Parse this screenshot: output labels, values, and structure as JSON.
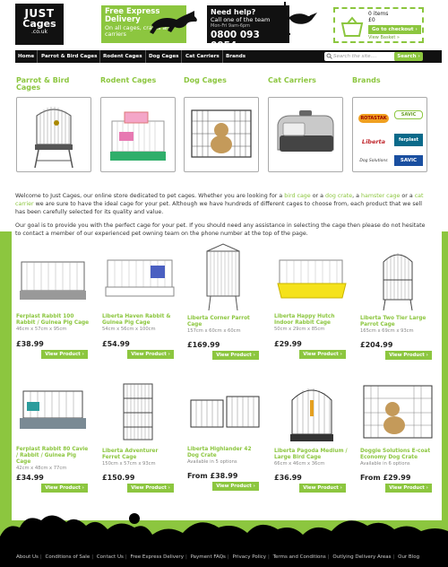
{
  "header": {
    "logo": {
      "line1": "JUST",
      "line2": "Cages",
      "line3": ".co.uk"
    },
    "delivery": {
      "title": "Free Express Delivery",
      "subtitle": "On all cages, crates and carriers"
    },
    "help": {
      "title": "Need help?",
      "subtitle": "Call one of the team",
      "hours": "Mon-Fri 9am-6pm",
      "phone": "0800 093 0054"
    },
    "basket": {
      "items": "0 items",
      "total": "£0",
      "checkout": "Go to checkout ›",
      "view": "View Basket »"
    }
  },
  "nav": {
    "items": [
      "Home",
      "Parrot & Bird Cages",
      "Rodent Cages",
      "Dog Cages",
      "Cat Carriers",
      "Brands"
    ],
    "search_placeholder": "Search the site....",
    "search_button": "Search ›"
  },
  "categories": [
    {
      "label": "Parrot & Bird Cages"
    },
    {
      "label": "Rodent Cages"
    },
    {
      "label": "Dog Cages"
    },
    {
      "label": "Cat Carriers"
    },
    {
      "label": "Brands"
    }
  ],
  "brands": [
    "ROTASTAK",
    "SAVIC",
    "Liberta",
    "ferplast",
    "Dog Solutions",
    "SAVIC"
  ],
  "intro": {
    "p1_a": "Welcome to Just Cages, our online store dedicated to pet cages. Whether you are looking for a ",
    "link1": "bird cage",
    "p1_b": " or a ",
    "link2": "dog crate",
    "p1_c": ", a ",
    "link3": "hamster cage",
    "p1_d": " or a ",
    "link4": "cat carrier",
    "p1_e": " we are sure to have the ideal cage for your pet. Although we have hundreds of different cages to choose from, each product that we sell has been carefully selected for its quality and value.",
    "p2": "Our goal is to provide you with the perfect cage for your pet. If you should need any assistance in selecting the cage then please do not hesitate to contact a member of our experienced pet owning team on the phone number at the top of the page."
  },
  "view_label": "View Product ›",
  "products": [
    {
      "name": "Ferplast Rabbit 100 Rabbit / Guinea Pig Cage",
      "size": "46cm x 57cm x 95cm",
      "price": "£38.99"
    },
    {
      "name": "Liberta Haven Rabbit & Guinea Pig Cage",
      "size": "54cm x 56cm x 100cm",
      "price": "£54.99"
    },
    {
      "name": "Liberta Corner Parrot Cage",
      "size": "157cm x 60cm x 60cm",
      "price": "£169.99"
    },
    {
      "name": "Liberta Happy Hutch Indoor Rabbit Cage",
      "size": "50cm x 29cm x 85cm",
      "price": "£29.99"
    },
    {
      "name": "Liberta Two Tier Large Parrot Cage",
      "size": "165cm x 69cm x 93cm",
      "price": "£204.99"
    },
    {
      "name": "Ferplast Rabbit 80 Cavie / Rabbit / Guinea Pig Cage",
      "size": "42cm x 48cm x 77cm",
      "price": "£34.99"
    },
    {
      "name": "Liberta Adventurer Ferret Cage",
      "size": "150cm x 57cm x 93cm",
      "price": "£150.99"
    },
    {
      "name": "Liberta Highlander 42 Dog Crate",
      "size": "Available in 5 options",
      "price": "From £38.99"
    },
    {
      "name": "Liberta Pagoda Medium / Large Bird Cage",
      "size": "66cm x 46cm x 36cm",
      "price": "£36.99"
    },
    {
      "name": "Doggie Solutions E-coat Economy Dog Crate",
      "size": "Available in 6 options",
      "price": "From £29.99"
    }
  ],
  "footer": [
    "About Us",
    "Conditions of Sale",
    "Contact Us",
    "Free Express Delivery",
    "Payment FAQs",
    "Privacy Policy",
    "Terms and Conditions",
    "Outlying Delivery Areas",
    "Our Blog"
  ],
  "colors": {
    "accent": "#8cc63f",
    "dark": "#111111"
  }
}
